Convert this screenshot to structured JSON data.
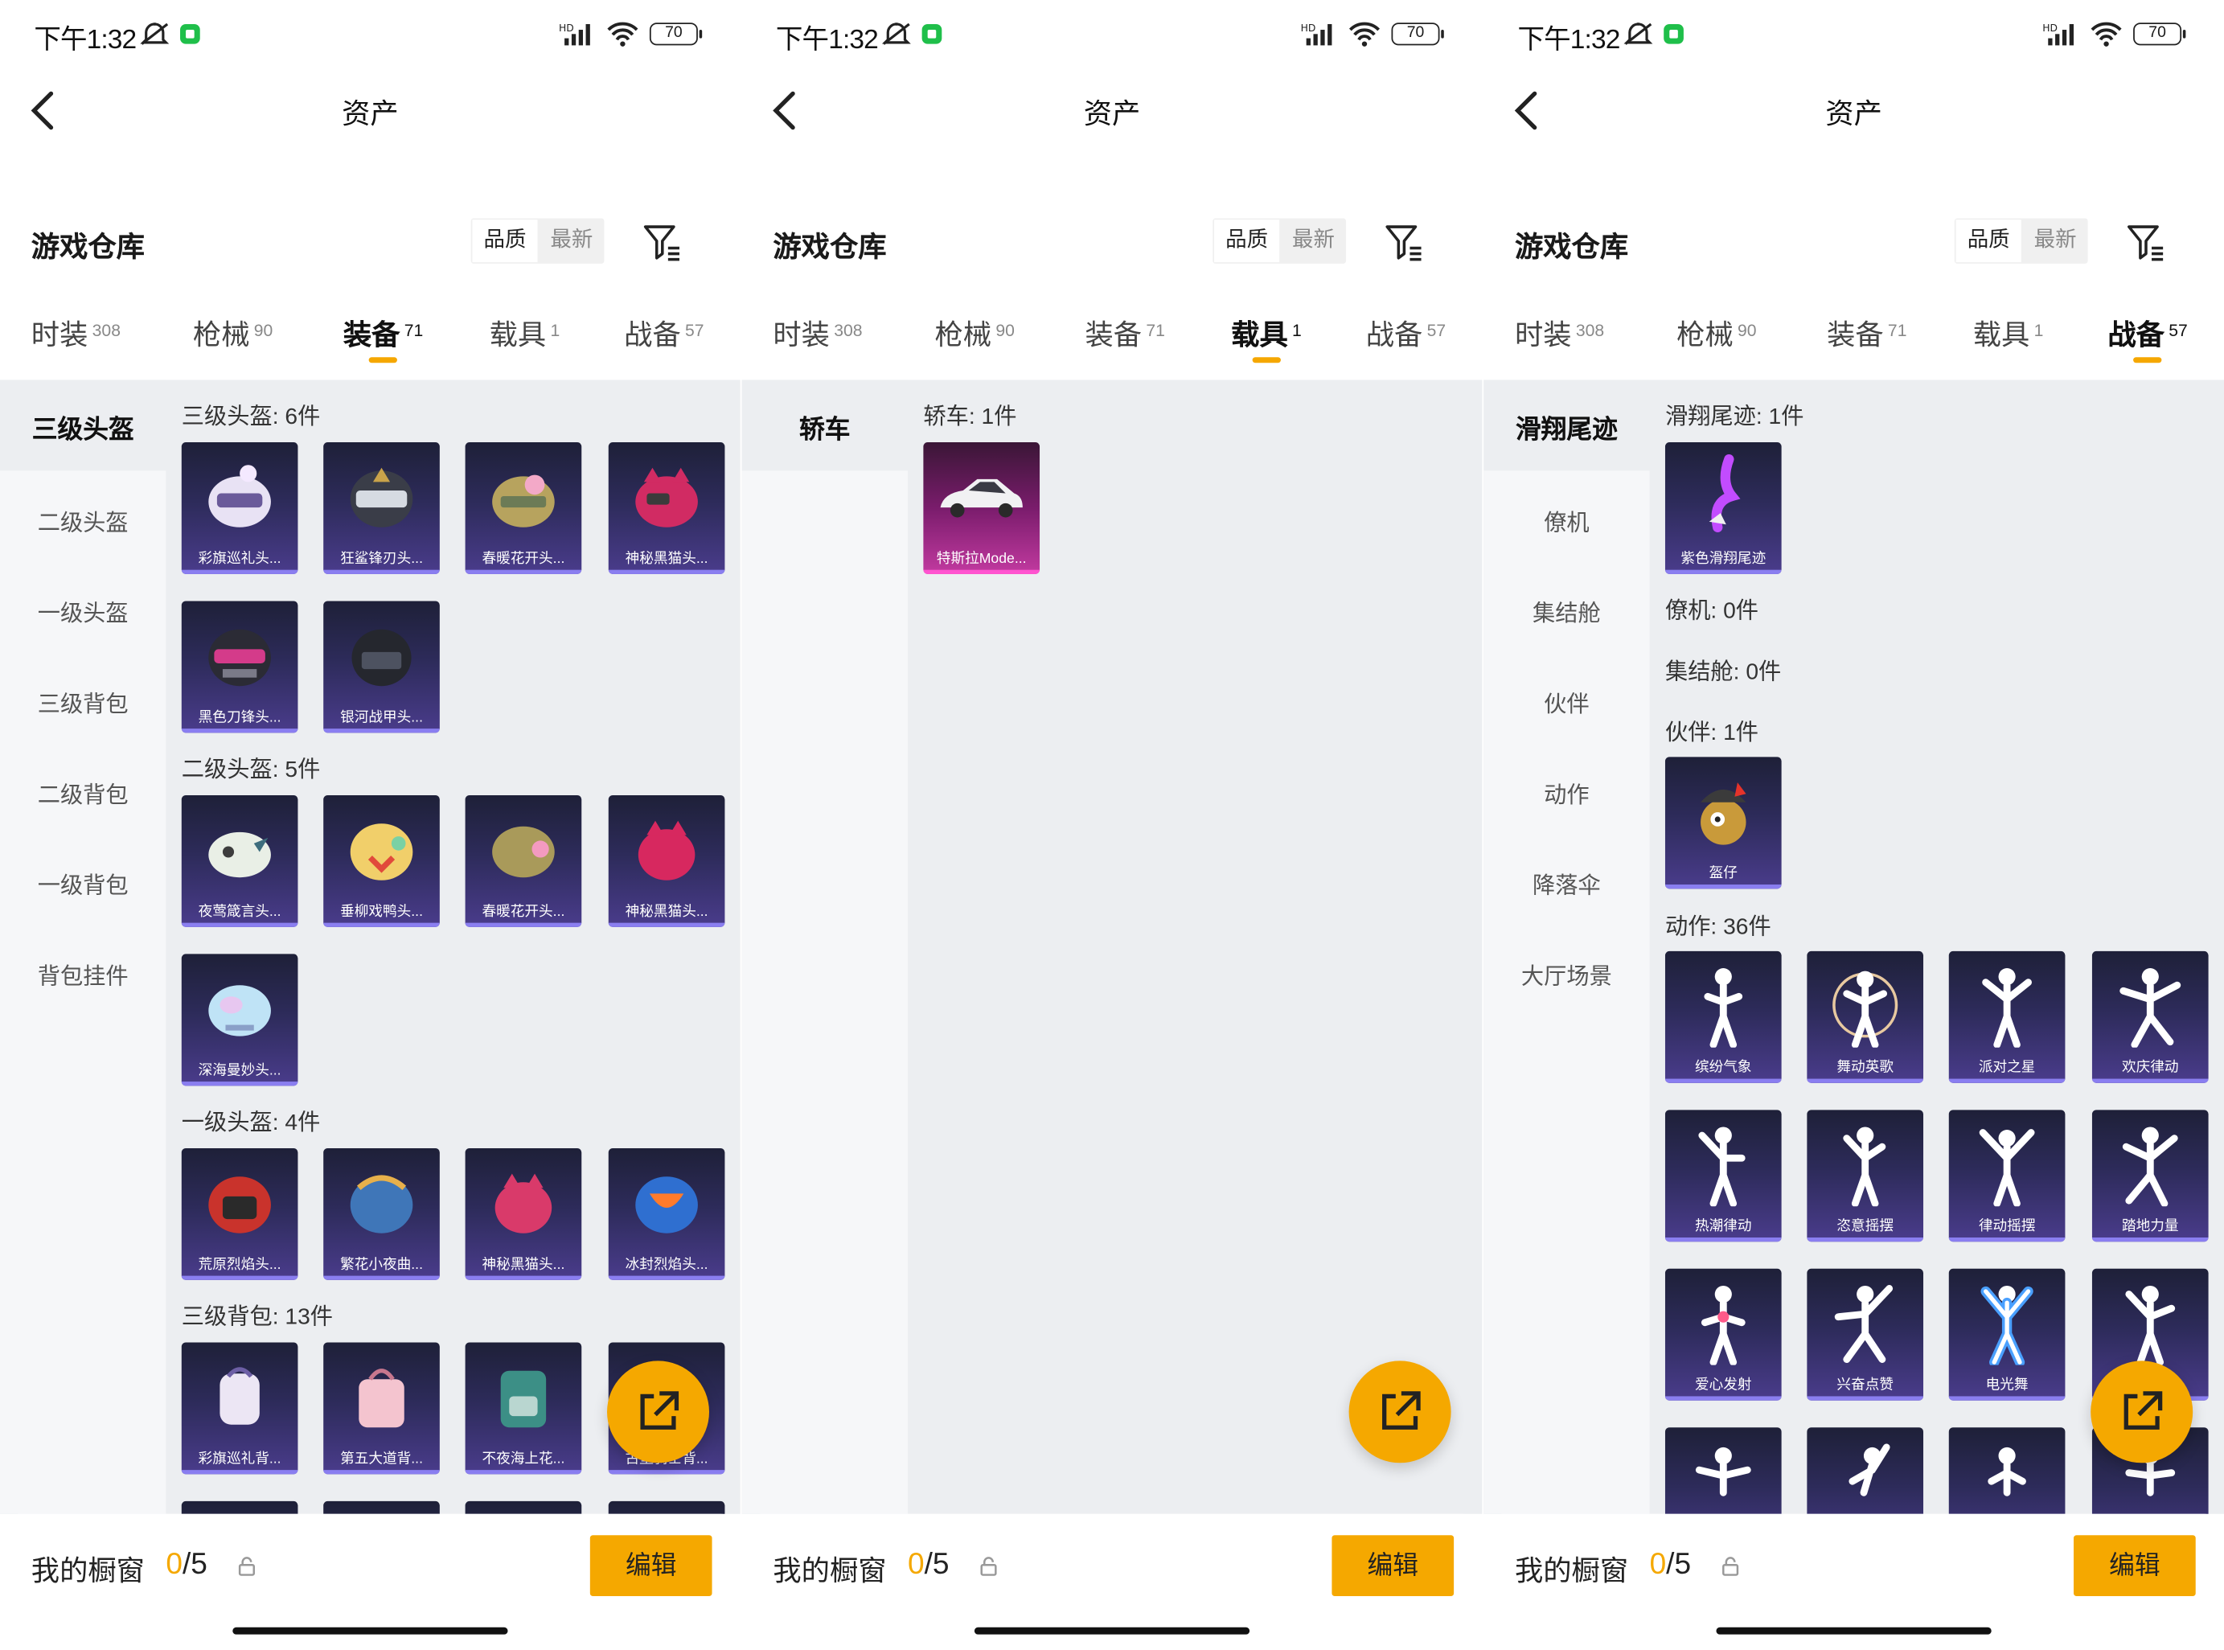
{
  "status_bar": {
    "time": "下午1:32",
    "battery": "70"
  },
  "nav": {
    "title": "资产"
  },
  "warehouse": {
    "title": "游戏仓库",
    "sort_quality": "品质",
    "sort_newest": "最新"
  },
  "tabs": [
    {
      "label": "时装",
      "count": "308"
    },
    {
      "label": "枪械",
      "count": "90"
    },
    {
      "label": "装备",
      "count": "71"
    },
    {
      "label": "载具",
      "count": "1"
    },
    {
      "label": "战备",
      "count": "57"
    }
  ],
  "screens": [
    {
      "active_tab": 2,
      "sidebar": [
        "三级头盔",
        "二级头盔",
        "一级头盔",
        "三级背包",
        "二级背包",
        "一级背包",
        "背包挂件"
      ],
      "sections": [
        {
          "title": "三级头盔: 6件",
          "items": [
            "彩旗巡礼头...",
            "狂鲨锋刃头...",
            "春暖花开头...",
            "神秘黑猫头...",
            "黑色刀锋头...",
            "银河战甲头..."
          ]
        },
        {
          "title": "二级头盔: 5件",
          "items": [
            "夜莺箴言头...",
            "垂柳戏鸭头...",
            "春暖花开头...",
            "神秘黑猫头...",
            "深海曼妙头..."
          ]
        },
        {
          "title": "一级头盔: 4件",
          "items": [
            "荒原烈焰头...",
            "繁花小夜曲...",
            "神秘黑猫头...",
            "冰封烈焰头..."
          ]
        },
        {
          "title": "三级背包: 13件",
          "items": [
            "彩旗巡礼背...",
            "第五大道背...",
            "不夜海上花...",
            "古堡骑士背..."
          ]
        }
      ]
    },
    {
      "active_tab": 3,
      "sidebar": [
        "轿车"
      ],
      "sections": [
        {
          "title": "轿车: 1件",
          "items": [
            "特斯拉Mode..."
          ]
        }
      ]
    },
    {
      "active_tab": 4,
      "sidebar": [
        "滑翔尾迹",
        "僚机",
        "集结舱",
        "伙伴",
        "动作",
        "降落伞",
        "大厅场景"
      ],
      "sections": [
        {
          "title": "滑翔尾迹: 1件",
          "items": [
            "紫色滑翔尾迹"
          ]
        },
        {
          "title": "僚机: 0件",
          "items": []
        },
        {
          "title": "集结舱: 0件",
          "items": []
        },
        {
          "title": "伙伴: 1件",
          "items": [
            "盔仔"
          ]
        },
        {
          "title": "动作: 36件",
          "items": [
            "缤纷气象",
            "舞动英歌",
            "派对之星",
            "欢庆律动",
            "热潮律动",
            "恣意摇摆",
            "律动摇摆",
            "踏地力量",
            "爱心发射",
            "兴奋点赞",
            "电光舞"
          ]
        }
      ]
    }
  ],
  "bottom": {
    "showcase_label": "我的橱窗",
    "count_current": "0",
    "count_total": "/5",
    "edit_label": "编辑"
  },
  "colors": {
    "accent": "#f5a800",
    "item_bg": "#2d2b5a",
    "vehicle_bg": "#c23aa0",
    "panel_bg": "#eceef1"
  }
}
